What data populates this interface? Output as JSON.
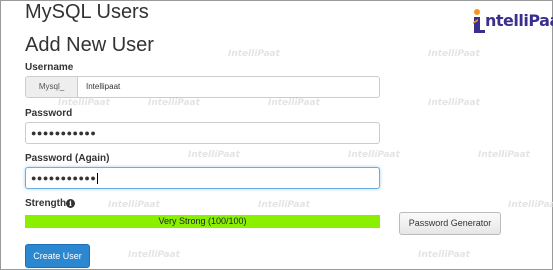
{
  "page": {
    "title": "MySQL Users",
    "section_title": "Add New User"
  },
  "brand": {
    "logo_text": "ntelliPaat",
    "watermark_text": "IntelliPaat",
    "accent": "#3a2f8f",
    "accent_orange": "#f7941d"
  },
  "form": {
    "username": {
      "label": "Username",
      "prefix": "Mysql_",
      "value": "Intellipaat"
    },
    "password": {
      "label": "Password",
      "masked_value": "●●●●●●●●●●●"
    },
    "password_again": {
      "label": "Password (Again)",
      "masked_value": "●●●●●●●●●●●"
    },
    "strength": {
      "label": "Strength",
      "info_icon": "info-icon",
      "text": "Very Strong (100/100)",
      "score": 100,
      "color": "#8af000"
    },
    "generator_button": "Password Generator",
    "create_button": "Create User"
  }
}
